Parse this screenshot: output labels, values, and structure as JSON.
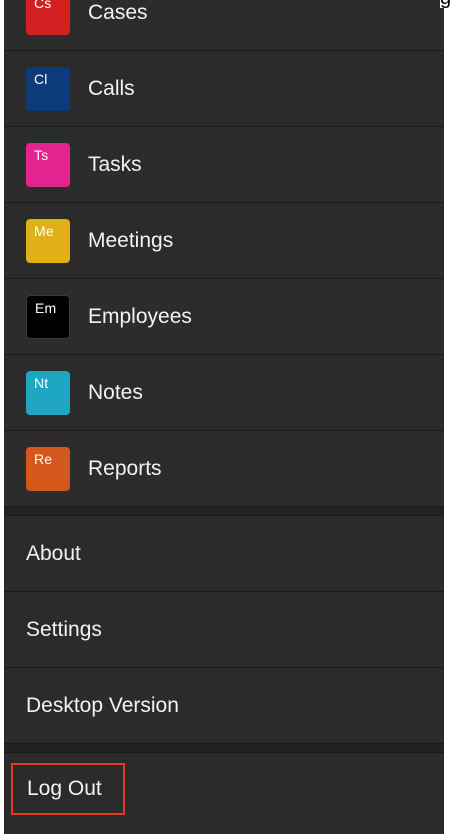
{
  "menu": {
    "modules": [
      {
        "abbr": "Cs",
        "label": "Cases",
        "color": "#d21f1f"
      },
      {
        "abbr": "Cl",
        "label": "Calls",
        "color": "#0d3a7a"
      },
      {
        "abbr": "Ts",
        "label": "Tasks",
        "color": "#e3238f"
      },
      {
        "abbr": "Me",
        "label": "Meetings",
        "color": "#e0b018"
      },
      {
        "abbr": "Em",
        "label": "Employees",
        "color": "#000000"
      },
      {
        "abbr": "Nt",
        "label": "Notes",
        "color": "#1ea6c3"
      },
      {
        "abbr": "Re",
        "label": "Reports",
        "color": "#d4571b"
      }
    ],
    "secondary": [
      {
        "label": "About"
      },
      {
        "label": "Settings"
      },
      {
        "label": "Desktop Version"
      }
    ],
    "logout": {
      "label": "Log Out",
      "highlight_color": "#e23a23"
    }
  },
  "corner_text": "g"
}
